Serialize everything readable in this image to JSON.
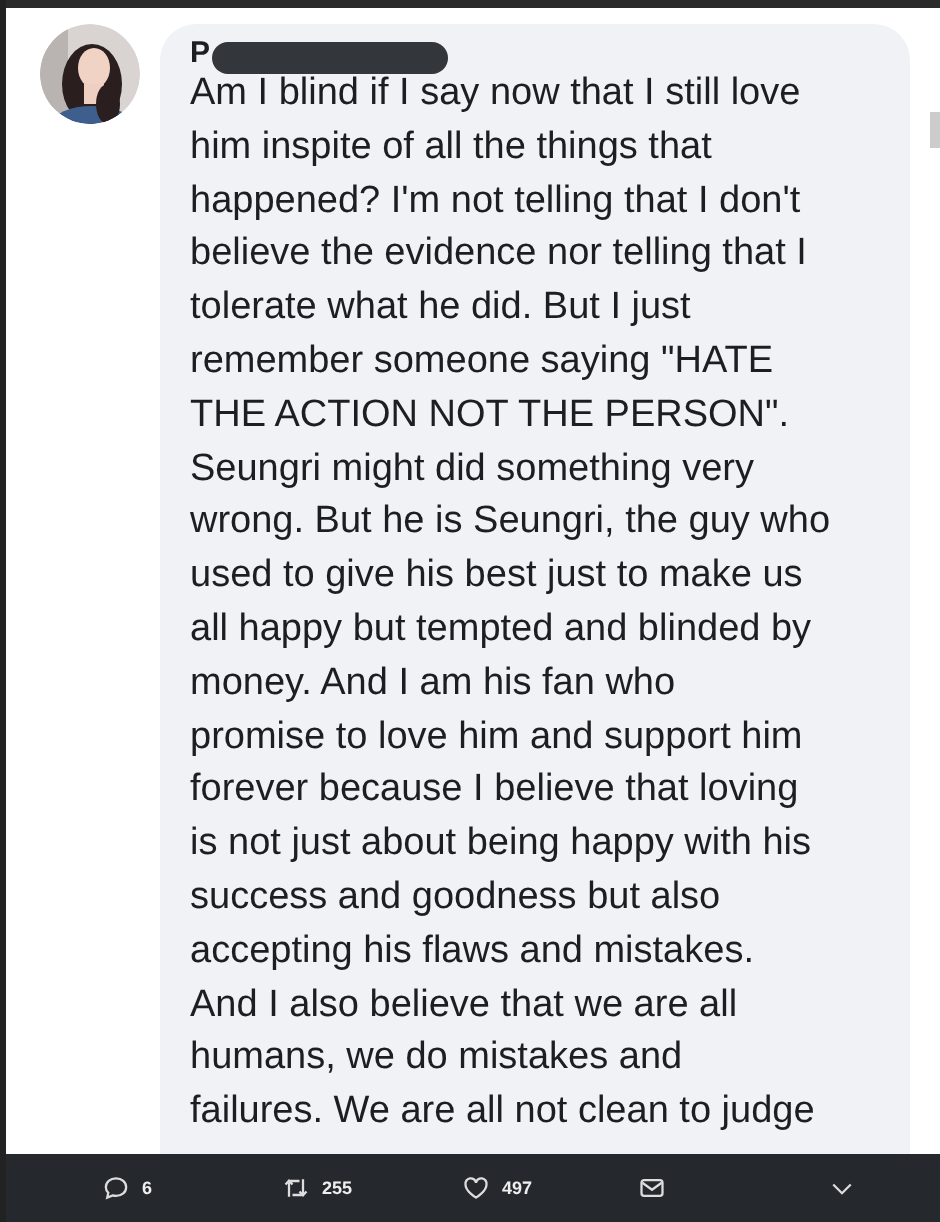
{
  "comment": {
    "author": "P",
    "author_redacted": true,
    "lines": [
      "Am I blind if I say now that I still love",
      "him inspite of all the things that",
      "happened? I'm not telling that I don't",
      "believe the evidence nor telling that I",
      "tolerate what he did. But I just",
      "remember someone saying \"HATE",
      "THE ACTION NOT THE PERSON\".",
      "Seungri might did something very",
      "wrong. But he is Seungri, the guy who",
      "used to give his best just to make us",
      "all happy but tempted and blinded by",
      "money.  And I am his fan who",
      "promise to love him and support him",
      "forever because I believe that loving",
      "is not just about being happy with his",
      "success and goodness but also",
      "accepting his flaws and mistakes.",
      "And I also believe that we are all",
      "humans, we do mistakes and",
      "failures. We are all not clean to judge"
    ]
  },
  "actions": [
    {
      "kind": "reply",
      "count": "6"
    },
    {
      "kind": "retweet",
      "count": "255"
    },
    {
      "kind": "like",
      "count": "497"
    },
    {
      "kind": "message"
    },
    {
      "kind": "more"
    }
  ]
}
